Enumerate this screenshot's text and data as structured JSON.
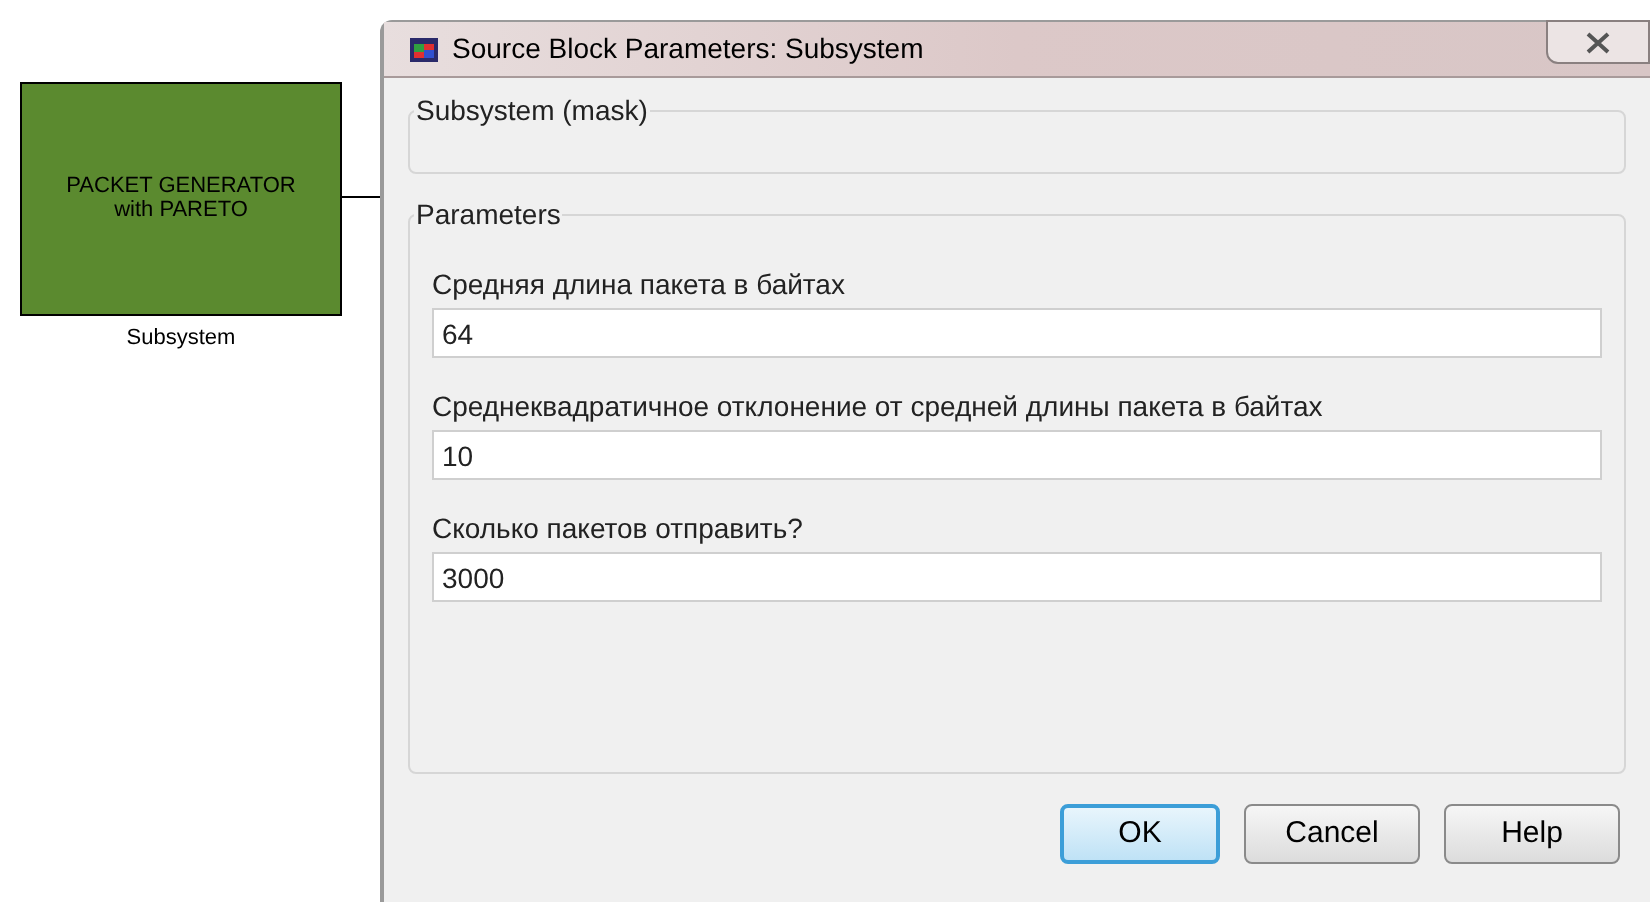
{
  "canvas": {
    "block": {
      "text_lines": [
        "PACKET GENERATOR",
        "with PARETO"
      ],
      "label": "Subsystem"
    }
  },
  "dialog": {
    "title": "Source Block Parameters: Subsystem",
    "mask_group": "Subsystem (mask)",
    "params_group": "Parameters",
    "params": [
      {
        "label": "Средняя длина пакета в байтах",
        "value": "64"
      },
      {
        "label": "Среднеквадратичное отклонение от средней длины пакета в байтах",
        "value": "10"
      },
      {
        "label": "Сколько пакетов отправить?",
        "value": "3000"
      }
    ],
    "buttons": [
      {
        "label": "OK",
        "focused": true
      },
      {
        "label": "Cancel",
        "focused": false
      },
      {
        "label": "Help",
        "focused": false
      }
    ]
  }
}
